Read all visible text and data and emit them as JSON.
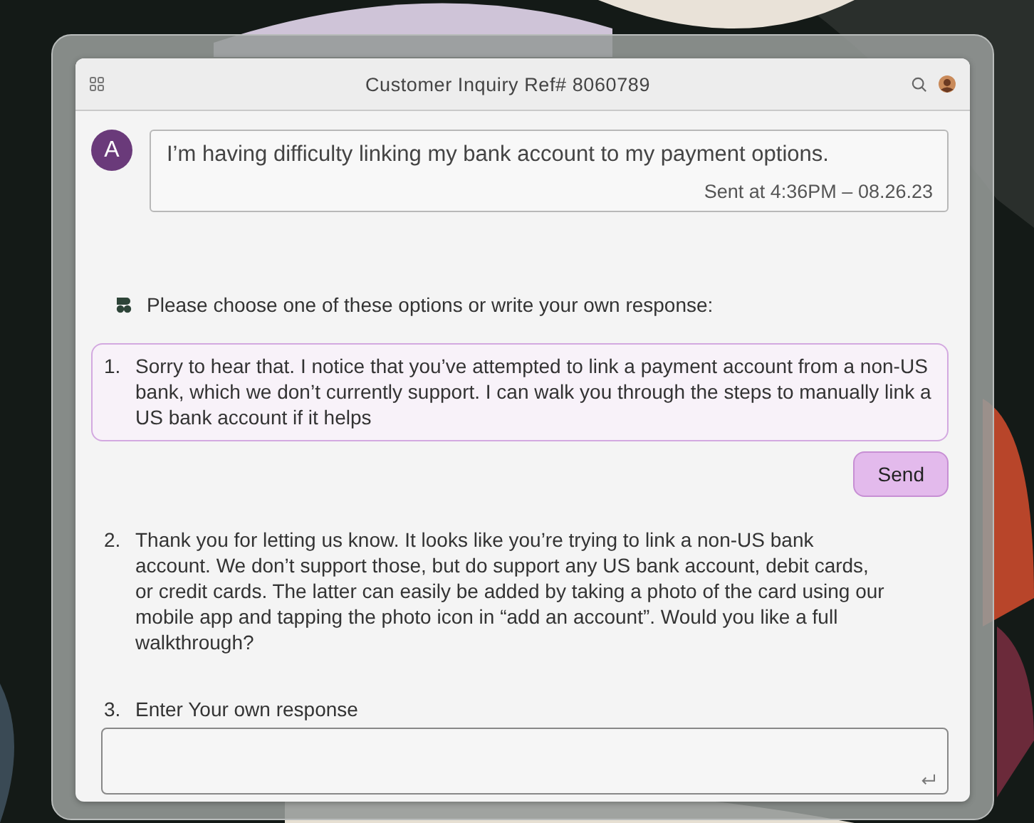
{
  "window": {
    "title": "Customer Inquiry Ref# 8060789"
  },
  "message": {
    "avatar": "A",
    "text": "I’m having difficulty linking my bank account to my payment options.",
    "sent": "Sent at 4:36PM – 08.26.23"
  },
  "prompt": "Please choose one of these options or write your own response:",
  "options": [
    {
      "kind": "text",
      "number": "1.",
      "text": "Sorry to hear that. I notice that you’ve attempted to link a payment account from a non-US bank, which we don’t currently support.  I can walk you through the steps to manually link a US bank account if it helps",
      "selected": true
    },
    {
      "kind": "text",
      "number": "2.",
      "text": "Thank you for letting us know. It looks like you’re trying to link a non-US bank account.  We don’t support those, but do support any US bank account, debit cards, or credit cards.  The latter can easily be added by taking a photo of the card using our mobile app and tapping the photo icon in “add an account”. Would you like a full walkthrough?",
      "selected": false
    },
    {
      "kind": "input",
      "number": "3.",
      "label": "Enter Your own response"
    }
  ],
  "send_button": "Send"
}
